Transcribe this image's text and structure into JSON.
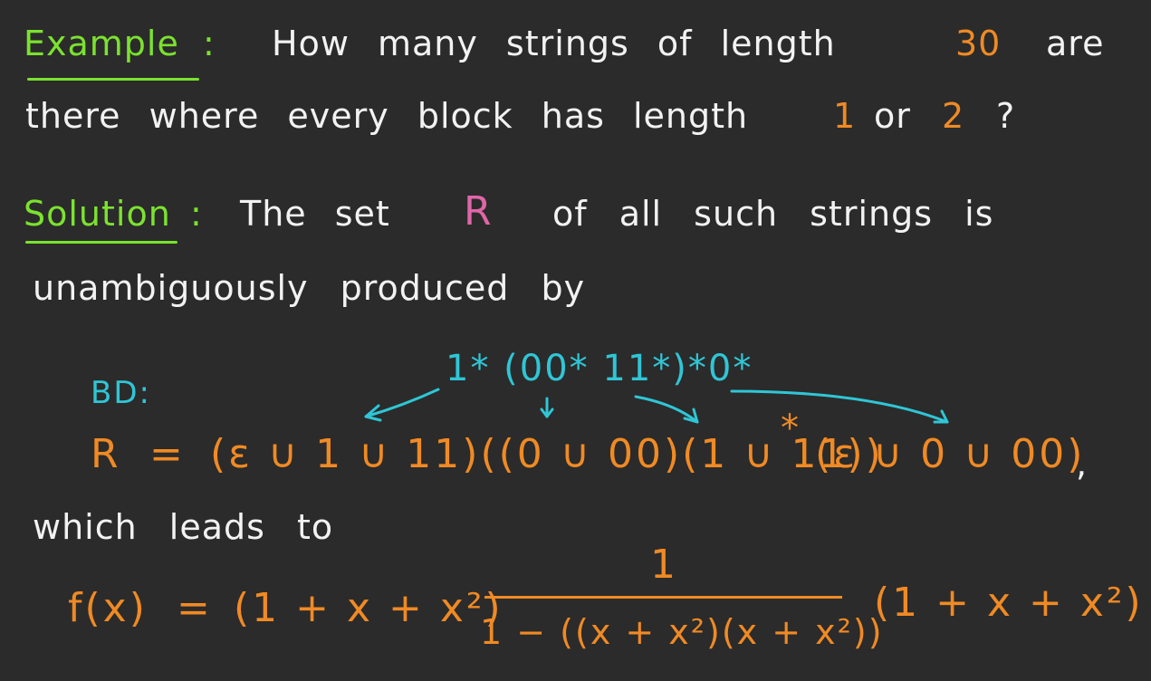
{
  "example": {
    "label": "Example",
    "colon": ":",
    "q1": "How many strings of length",
    "n": "30",
    "q2": "are",
    "q3": "there where every block has length",
    "one": "1",
    "or": "or",
    "two": "2",
    "qmark": "?"
  },
  "solution": {
    "label": "Solution",
    "colon": ":",
    "t1": "The set",
    "set": "R",
    "t2": "of all such strings is",
    "t3": "unambiguously produced by"
  },
  "bd": {
    "label": "BD:",
    "expr": "1* (00* 11*)*0*"
  },
  "r_expr": {
    "lhs": "R",
    "eq": "=",
    "rhs_a": "(ε ∪ 1 ∪ 11)((0 ∪ 00)(1 ∪ 11))",
    "star": "*",
    "rhs_b": "(ε ∪ 0 ∪ 00)",
    "comma": ","
  },
  "leads": "which leads to",
  "fx": {
    "lhs": "f(x)",
    "eq": "=",
    "pre": "(1 + x + x²)",
    "num": "1",
    "den": "1 − ((x + x²)(x + x²))",
    "post": "(1 + x + x²)"
  },
  "colors": {
    "background": "#2b2b2b",
    "heading": "#7be22f",
    "orange": "#f08a24",
    "pink": "#e066a8",
    "cyan": "#2fc6d6"
  }
}
